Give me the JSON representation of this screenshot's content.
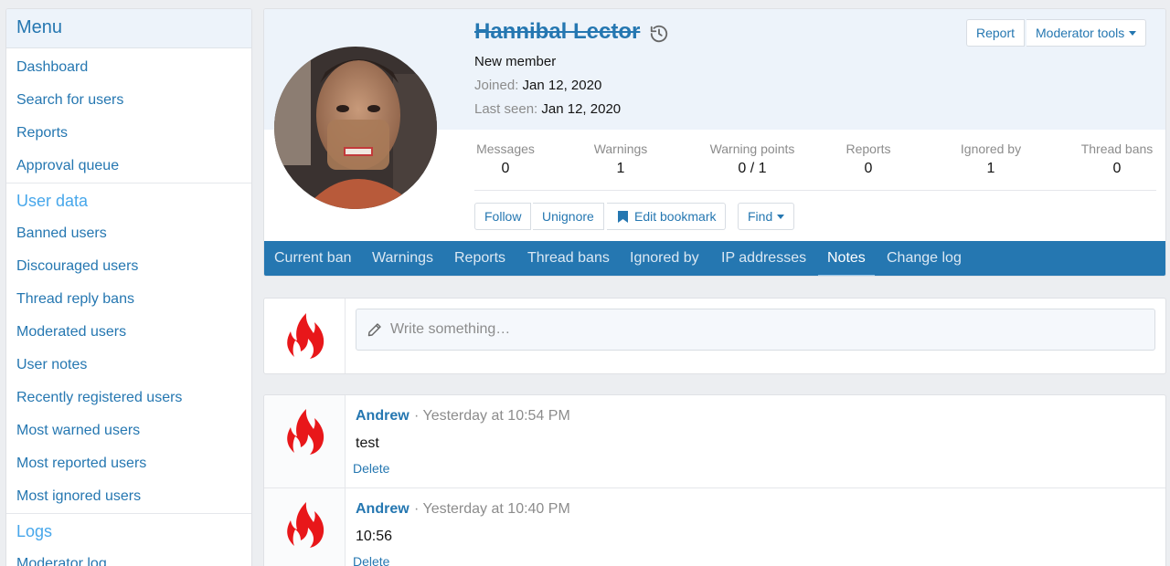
{
  "sidebar": {
    "menu_title": "Menu",
    "menu_items": [
      "Dashboard",
      "Search for users",
      "Reports",
      "Approval queue"
    ],
    "user_data_title": "User data",
    "user_data_items": [
      "Banned users",
      "Discouraged users",
      "Thread reply bans",
      "Moderated users",
      "User notes",
      "Recently registered users",
      "Most warned users",
      "Most reported users",
      "Most ignored users"
    ],
    "logs_title": "Logs",
    "logs_items": [
      "Moderator log"
    ]
  },
  "profile": {
    "username": "Hannibal Lector",
    "user_title": "New member",
    "joined_label": "Joined:",
    "joined_value": "Jan 12, 2020",
    "last_seen_label": "Last seen:",
    "last_seen_value": "Jan 12, 2020",
    "report_button": "Report",
    "moderator_tools_button": "Moderator tools",
    "stats": [
      {
        "label": "Messages",
        "value": "0"
      },
      {
        "label": "Warnings",
        "value": "1"
      },
      {
        "label": "Warning points",
        "value": "0 / 1"
      },
      {
        "label": "Reports",
        "value": "0"
      },
      {
        "label": "Ignored by",
        "value": "1"
      },
      {
        "label": "Thread bans",
        "value": "0"
      }
    ],
    "actions": {
      "follow": "Follow",
      "unignore": "Unignore",
      "edit_bookmark": "Edit bookmark",
      "find": "Find"
    },
    "tabs": [
      "Current ban",
      "Warnings",
      "Reports",
      "Thread bans",
      "Ignored by",
      "IP addresses",
      "Notes",
      "Change log"
    ],
    "active_tab": "Notes"
  },
  "composer": {
    "placeholder": "Write something…"
  },
  "notes": [
    {
      "author": "Andrew",
      "separator": "·",
      "time": "Yesterday at 10:54 PM",
      "body": "test",
      "delete_label": "Delete"
    },
    {
      "author": "Andrew",
      "separator": "·",
      "time": "Yesterday at 10:40 PM",
      "body": "10:56",
      "delete_label": "Delete"
    }
  ],
  "colors": {
    "link": "#2577b1",
    "tab_bar": "#2577b1",
    "header_bg": "#edf3fa",
    "fire_icon": "#e8171a"
  }
}
